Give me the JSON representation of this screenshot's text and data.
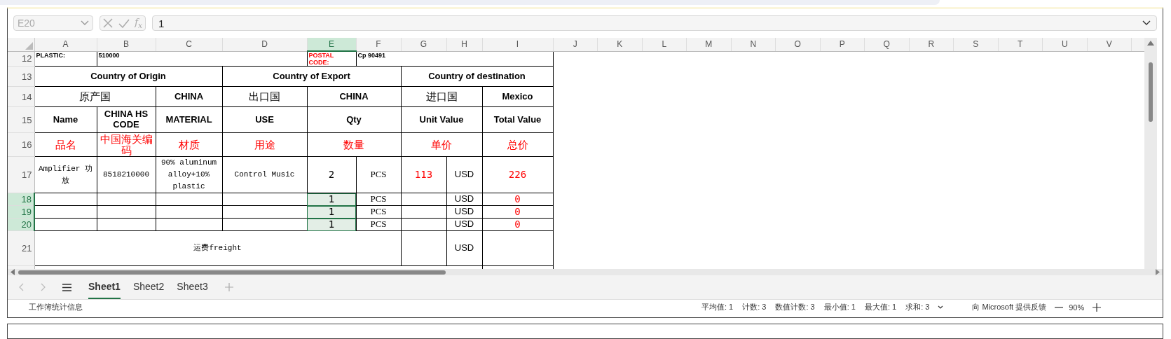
{
  "formula_bar": {
    "name_box": "E20",
    "function_label": "f$_{x}$",
    "formula": "1"
  },
  "columns": [
    {
      "label": "A",
      "selected": false
    },
    {
      "label": "B",
      "selected": false
    },
    {
      "label": "C",
      "selected": false
    },
    {
      "label": "D",
      "selected": false
    },
    {
      "label": "E",
      "selected": true
    },
    {
      "label": "F",
      "selected": false
    },
    {
      "label": "G",
      "selected": false
    },
    {
      "label": "H",
      "selected": false
    },
    {
      "label": "I",
      "selected": false
    },
    {
      "label": "J",
      "selected": false
    },
    {
      "label": "K",
      "selected": false
    },
    {
      "label": "L",
      "selected": false
    },
    {
      "label": "M",
      "selected": false
    },
    {
      "label": "N",
      "selected": false
    },
    {
      "label": "O",
      "selected": false
    },
    {
      "label": "P",
      "selected": false
    },
    {
      "label": "Q",
      "selected": false
    },
    {
      "label": "R",
      "selected": false
    },
    {
      "label": "S",
      "selected": false
    },
    {
      "label": "T",
      "selected": false
    },
    {
      "label": "U",
      "selected": false
    },
    {
      "label": "V",
      "selected": false
    }
  ],
  "rows": [
    {
      "number": "12",
      "selected": false,
      "cells": [
        {
          "text": "PLASTIC:",
          "kind": "small",
          "color": "#000000",
          "selected": false
        },
        {
          "text": "510000",
          "kind": "small",
          "color": "#000000",
          "selected": false
        },
        {
          "text": "POSTAL CODE:",
          "kind": "small",
          "color": "#ff0000",
          "selected": false
        },
        {
          "text": "Cp 90491",
          "kind": "small",
          "color": "#000000",
          "selected": false
        }
      ]
    },
    {
      "number": "13",
      "selected": false,
      "cells": [
        {
          "text": "Country of Origin",
          "kind": "header",
          "color": "#000000",
          "selected": false
        },
        {
          "text": "Country of Export",
          "kind": "header",
          "color": "#000000",
          "selected": false
        },
        {
          "text": "Country of destination",
          "kind": "header",
          "color": "#000000",
          "selected": false
        }
      ]
    },
    {
      "number": "14",
      "selected": false,
      "cells": [
        {
          "text": "原产国",
          "kind": "cn",
          "color": "#000000",
          "selected": false
        },
        {
          "text": "CHINA",
          "kind": "header",
          "color": "#000000",
          "selected": false
        },
        {
          "text": "出口国",
          "kind": "cn",
          "color": "#000000",
          "selected": false
        },
        {
          "text": "CHINA",
          "kind": "header",
          "color": "#000000",
          "selected": false
        },
        {
          "text": "进口国",
          "kind": "cn",
          "color": "#000000",
          "selected": false
        },
        {
          "text": "Mexico",
          "kind": "header",
          "color": "#000000",
          "selected": false
        }
      ]
    },
    {
      "number": "15",
      "selected": false,
      "cells": [
        {
          "text": "Name",
          "kind": "header",
          "color": "#000000",
          "selected": false
        },
        {
          "text": "CHINA HS CODE",
          "kind": "header",
          "color": "#000000",
          "selected": false
        },
        {
          "text": "MATERIAL",
          "kind": "header",
          "color": "#000000",
          "selected": false
        },
        {
          "text": "USE",
          "kind": "header",
          "color": "#000000",
          "selected": false
        },
        {
          "text": "Qty",
          "kind": "header",
          "color": "#000000",
          "selected": false
        },
        {
          "text": "Unit Value",
          "kind": "header",
          "color": "#000000",
          "selected": false
        },
        {
          "text": "Total Value",
          "kind": "header",
          "color": "#000000",
          "selected": false
        }
      ]
    },
    {
      "number": "16",
      "selected": false,
      "cells": [
        {
          "text": "品名",
          "kind": "cn",
          "color": "#ff0000",
          "selected": false
        },
        {
          "text": "中国海关编码",
          "kind": "cn",
          "color": "#ff0000",
          "selected": false
        },
        {
          "text": "材质",
          "kind": "cn",
          "color": "#ff0000",
          "selected": false
        },
        {
          "text": "用途",
          "kind": "cn",
          "color": "#ff0000",
          "selected": false
        },
        {
          "text": "数量",
          "kind": "cn",
          "color": "#ff0000",
          "selected": false
        },
        {
          "text": "单价",
          "kind": "cn",
          "color": "#ff0000",
          "selected": false
        },
        {
          "text": "总价",
          "kind": "cn",
          "color": "#ff0000",
          "selected": false
        }
      ]
    },
    {
      "number": "17",
      "selected": false,
      "cells": [
        {
          "text": "Amplifier 功放",
          "kind": "mono",
          "color": "#000000",
          "selected": false
        },
        {
          "text": "8518210000",
          "kind": "mono",
          "color": "#000000",
          "selected": false
        },
        {
          "text": "90% aluminum alloy+10% plastic",
          "kind": "mono",
          "color": "#000000",
          "selected": false
        },
        {
          "text": "Control Music",
          "kind": "mono",
          "color": "#000000",
          "selected": false
        },
        {
          "text": "2",
          "kind": "num",
          "color": "#000000",
          "selected": false
        },
        {
          "text": "PCS",
          "kind": "serif",
          "color": "#000000",
          "selected": false
        },
        {
          "text": "113",
          "kind": "num",
          "color": "#ff0000",
          "selected": false
        },
        {
          "text": "USD",
          "kind": "sans",
          "color": "#000000",
          "selected": false
        },
        {
          "text": "226",
          "kind": "num",
          "color": "#ff0000",
          "selected": false
        }
      ]
    },
    {
      "number": "18",
      "selected": true,
      "cells": [
        {
          "selected": false
        },
        {
          "selected": false
        },
        {
          "selected": false
        },
        {
          "selected": false
        },
        {
          "text": "1",
          "kind": "num",
          "color": "#000000",
          "selected": true
        },
        {
          "text": "PCS",
          "kind": "serif",
          "color": "#000000",
          "selected": false
        },
        {
          "selected": false
        },
        {
          "text": "USD",
          "kind": "sans",
          "color": "#000000",
          "selected": false
        },
        {
          "text": "0",
          "kind": "num",
          "color": "#ff0000",
          "selected": false
        }
      ]
    },
    {
      "number": "19",
      "selected": true,
      "cells": [
        {
          "selected": false
        },
        {
          "selected": false
        },
        {
          "selected": false
        },
        {
          "selected": false
        },
        {
          "text": "1",
          "kind": "num",
          "color": "#000000",
          "selected": true
        },
        {
          "text": "PCS",
          "kind": "serif",
          "color": "#000000",
          "selected": false
        },
        {
          "selected": false
        },
        {
          "text": "USD",
          "kind": "sans",
          "color": "#000000",
          "selected": false
        },
        {
          "text": "0",
          "kind": "num",
          "color": "#ff0000",
          "selected": false
        }
      ]
    },
    {
      "number": "20",
      "selected": true,
      "cells": [
        {
          "selected": false
        },
        {
          "selected": false
        },
        {
          "selected": false
        },
        {
          "selected": false
        },
        {
          "text": "1",
          "kind": "num",
          "color": "#000000",
          "selected": true
        },
        {
          "text": "PCS",
          "kind": "serif",
          "color": "#000000",
          "selected": false
        },
        {
          "selected": false
        },
        {
          "text": "USD",
          "kind": "sans",
          "color": "#000000",
          "selected": false
        },
        {
          "text": "0",
          "kind": "num",
          "color": "#ff0000",
          "selected": false
        }
      ]
    },
    {
      "number": "21",
      "selected": false,
      "cells": [
        {
          "text": "运费freight",
          "kind": "mono",
          "color": "#000000",
          "selected": false
        },
        {
          "selected": false
        },
        {
          "text": "USD",
          "kind": "sans",
          "color": "#000000",
          "selected": false
        },
        {
          "selected": false
        }
      ]
    }
  ],
  "sheet_tabs": [
    {
      "label": "Sheet1",
      "selected": true
    },
    {
      "label": "Sheet2",
      "selected": false
    },
    {
      "label": "Sheet3",
      "selected": false
    }
  ],
  "status_bar": {
    "info": "工作簿统计信息",
    "stats": [
      "平均值: 1",
      "计数: 3",
      "数值计数: 3",
      "最小值: 1",
      "最大值: 1",
      "求和: 3"
    ],
    "feedback": "向 Microsoft 提供反馈",
    "zoom": "90%"
  }
}
